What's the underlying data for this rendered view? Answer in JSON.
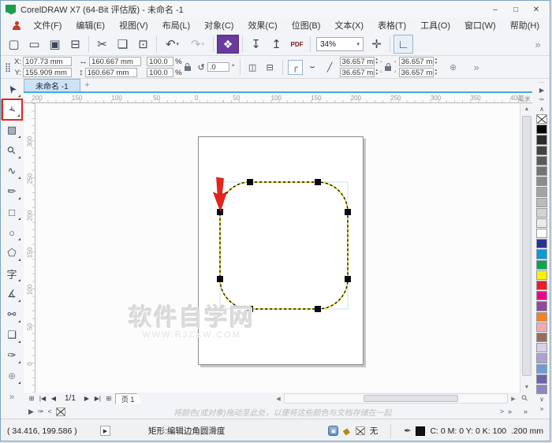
{
  "window": {
    "title": "CorelDRAW X7 (64-Bit 评估版) - 未命名 -1",
    "minimize": "–",
    "maximize": "□",
    "close": "✕"
  },
  "menubar": {
    "items": [
      {
        "id": "file",
        "label": "文件(F)"
      },
      {
        "id": "edit",
        "label": "编辑(E)"
      },
      {
        "id": "view",
        "label": "视图(V)"
      },
      {
        "id": "layout",
        "label": "布局(L)"
      },
      {
        "id": "object",
        "label": "对象(C)"
      },
      {
        "id": "effects",
        "label": "效果(C)"
      },
      {
        "id": "bitmaps",
        "label": "位图(B)"
      },
      {
        "id": "text",
        "label": "文本(X)"
      },
      {
        "id": "table",
        "label": "表格(T)"
      },
      {
        "id": "tools",
        "label": "工具(O)"
      },
      {
        "id": "window",
        "label": "窗口(W)"
      },
      {
        "id": "help",
        "label": "帮助(H)"
      }
    ]
  },
  "toolbar": {
    "zoom_level": "34%",
    "items": [
      {
        "id": "new-document",
        "glyph": "▢"
      },
      {
        "id": "open",
        "glyph": "▭"
      },
      {
        "id": "save",
        "glyph": "▣"
      },
      {
        "id": "print",
        "glyph": "⊟"
      },
      {
        "type": "sep"
      },
      {
        "id": "cut",
        "glyph": "✂"
      },
      {
        "id": "copy",
        "glyph": "❏"
      },
      {
        "id": "paste",
        "glyph": "⊡"
      },
      {
        "type": "sep"
      },
      {
        "id": "undo",
        "glyph": "↶",
        "arrow": true
      },
      {
        "id": "redo",
        "glyph": "↷",
        "arrow": true,
        "disabled": true
      },
      {
        "type": "sep"
      },
      {
        "id": "app-launcher",
        "glyph": "❖",
        "accent": true
      },
      {
        "type": "sep"
      },
      {
        "id": "import",
        "glyph": "↧"
      },
      {
        "id": "export",
        "glyph": "↥"
      },
      {
        "id": "publish-pdf",
        "glyph": "PDF",
        "pdf": true
      },
      {
        "type": "sep"
      },
      {
        "type": "zoom"
      },
      {
        "id": "full-screen-preview",
        "glyph": "✛"
      },
      {
        "type": "sep"
      },
      {
        "id": "show-rulers",
        "glyph": "∟",
        "pressed": true
      }
    ],
    "overflow": "»"
  },
  "propbar": {
    "pos_icon": "⣿",
    "x_label": "X:",
    "x_value": "107.73 mm",
    "y_label": "Y:",
    "y_value": "155.909 mm",
    "width_icon": "↔",
    "width_value": "160.667 mm",
    "height_icon": "↕",
    "height_value": "160.667 mm",
    "scale_h": "100.0",
    "scale_v": "100.0",
    "percent": "%",
    "rotate_icon": "↺",
    "rotation_value": ".0",
    "degree": "°",
    "mirror_h_icon": "◫",
    "mirror_v_icon": "⊟",
    "corner_round_icon": "╭",
    "corner_scallop_icon": "⌣",
    "corner_chamfer_icon": "╱",
    "corner_tl": "36.657 mm",
    "corner_bl": "36.657 mm",
    "corner_tr": "36.657 mm",
    "corner_br": "36.657 mm",
    "mark_tl": "⌜",
    "mark_bl": "⌞",
    "mark_tr": "⌝",
    "mark_br": "⌟",
    "spin_up": "▴",
    "spin_down": "▾",
    "relative_icon": "⊕",
    "more": "»"
  },
  "tabs": {
    "active": "未命名 -1",
    "add": "+"
  },
  "rulers": {
    "horizontal": [
      "200",
      "150",
      "100",
      "50",
      "0",
      "50",
      "100",
      "150",
      "200",
      "250",
      "300",
      "350",
      "400"
    ],
    "vertical": [
      "300",
      "250",
      "200",
      "150",
      "100",
      "50",
      "0"
    ],
    "unit": "毫米"
  },
  "toolbox": {
    "items": [
      {
        "id": "pick-tool",
        "glyph": "➤",
        "rot": "-125deg",
        "fly": true
      },
      {
        "id": "shape-tool",
        "glyph": "➢",
        "rot": "35deg",
        "fly": true,
        "selected": true,
        "highlighted": true
      },
      {
        "id": "crop-tool",
        "glyph": "▨",
        "fly": true
      },
      {
        "id": "zoom-tool",
        "glyph": "⚲",
        "rot": "-45deg",
        "fly": true
      },
      {
        "id": "freehand-tool",
        "glyph": "∿",
        "fly": true
      },
      {
        "id": "artistic-media-tool",
        "glyph": "✏",
        "fly": true
      },
      {
        "id": "rectangle-tool",
        "glyph": "□",
        "fly": true
      },
      {
        "id": "ellipse-tool",
        "glyph": "○",
        "fly": true
      },
      {
        "id": "polygon-tool",
        "glyph": "⬠",
        "fly": true
      },
      {
        "id": "text-tool",
        "glyph": "字",
        "fly": true
      },
      {
        "id": "dimension-tool",
        "glyph": "∡",
        "fly": true
      },
      {
        "id": "connector-tool",
        "glyph": "⚯",
        "fly": true
      },
      {
        "id": "drop-shadow-tool",
        "glyph": "❏",
        "fly": true
      },
      {
        "id": "eyedropper-tool",
        "glyph": "✑",
        "fly": true
      },
      {
        "id": "interactive-fill-tool",
        "glyph": "⊕",
        "fly": true,
        "dim": true
      },
      {
        "id": "toolbox-overflow",
        "glyph": "»",
        "dim": true
      }
    ]
  },
  "palette": {
    "header_dots": "⋯",
    "flyout": "▶",
    "eyedropper": "✑",
    "scroll_up": "∧",
    "scroll_down": "∨",
    "more": "»",
    "colors": [
      "none",
      "#000000",
      "#2b2b2b",
      "#434343",
      "#5b5b5b",
      "#737373",
      "#8b8b8b",
      "#a3a3a3",
      "#bbbbbb",
      "#d3d3d3",
      "#ebebeb",
      "#ffffff",
      "#2e3192",
      "#0a99dc",
      "#00a651",
      "#fff200",
      "#ed1c24",
      "#ec008c",
      "#8e4a9e",
      "#f58220",
      "#f3a9b8",
      "#94705a",
      "#d5d2e8",
      "#aaa3d4",
      "#6a9ddc",
      "#6864ae",
      "#8d86c5"
    ]
  },
  "navigator": {
    "add_page_start": "⊞",
    "first": "|◀",
    "prev": "◀",
    "indicator": "1/1",
    "next": "▶",
    "last": "▶|",
    "add_page_end": "⊞",
    "page_tab": "页 1"
  },
  "scrollbars": {
    "left": "◀",
    "right": "▶",
    "up": "▲",
    "down": "▼",
    "zoom_tool": "⚲"
  },
  "color_tray": {
    "flyout": "▶",
    "eyedropper": "✑",
    "scroll_left": "<",
    "scroll_right": ">",
    "more": "»",
    "hint": "将颜色(或对象)拖动至此处，以便将这些颜色与文档存储在一起"
  },
  "statusbar": {
    "coords": "( 34.416, 199.586 )",
    "expand": "▶",
    "hint": "矩形:编辑边角圆滑度",
    "fill_none": "无",
    "outline_cmyk": "C: 0 M: 0 Y: 0 K: 100",
    "outline_width": ".200 mm",
    "doc_icon": "▣",
    "bucket_icon": "◆",
    "pen_icon": "✒"
  },
  "canvas": {
    "watermark_title": "软件自学网",
    "watermark_url": "WWW.RJZXW.COM"
  }
}
